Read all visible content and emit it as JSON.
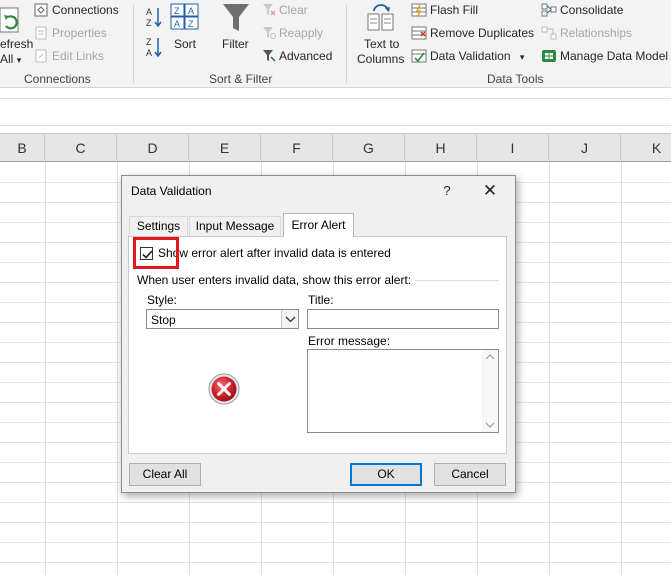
{
  "ribbon": {
    "connections_group": {
      "refresh_all_label_1": "efresh",
      "refresh_all_label_2": "All",
      "connections": "Connections",
      "properties": "Properties",
      "edit_links": "Edit Links",
      "group_label": "Connections"
    },
    "sort_filter_group": {
      "sort": "Sort",
      "filter": "Filter",
      "clear": "Clear",
      "reapply": "Reapply",
      "advanced": "Advanced",
      "group_label": "Sort & Filter"
    },
    "data_tools_group": {
      "text_to_columns_1": "Text to",
      "text_to_columns_2": "Columns",
      "flash_fill": "Flash Fill",
      "remove_duplicates": "Remove Duplicates",
      "data_validation": "Data Validation",
      "consolidate": "Consolidate",
      "relationships": "Relationships",
      "manage_data_model": "Manage Data Model",
      "group_label": "Data Tools"
    }
  },
  "grid": {
    "columns": [
      "B",
      "C",
      "D",
      "E",
      "F",
      "G",
      "H",
      "I",
      "J",
      "K"
    ]
  },
  "dialog": {
    "title": "Data Validation",
    "help_symbol": "?",
    "close_symbol": "✕",
    "tabs": [
      {
        "label": "Settings",
        "active": false
      },
      {
        "label": "Input Message",
        "active": false
      },
      {
        "label": "Error Alert",
        "active": true
      }
    ],
    "show_alert_checkbox": {
      "label": "Show error alert after invalid data is entered",
      "checked": true
    },
    "section_label": "When user enters invalid data, show this error alert:",
    "style_label": "Style:",
    "style_value": "Stop",
    "title_label": "Title:",
    "title_value": "",
    "message_label": "Error message:",
    "message_value": "",
    "style_icon": "stop-error-icon",
    "buttons": {
      "clear_all": "Clear All",
      "ok": "OK",
      "cancel": "Cancel"
    }
  },
  "colors": {
    "highlight_box": "#e3171c",
    "stop_icon_red": "#d4202a",
    "ok_border": "#0078d7"
  }
}
